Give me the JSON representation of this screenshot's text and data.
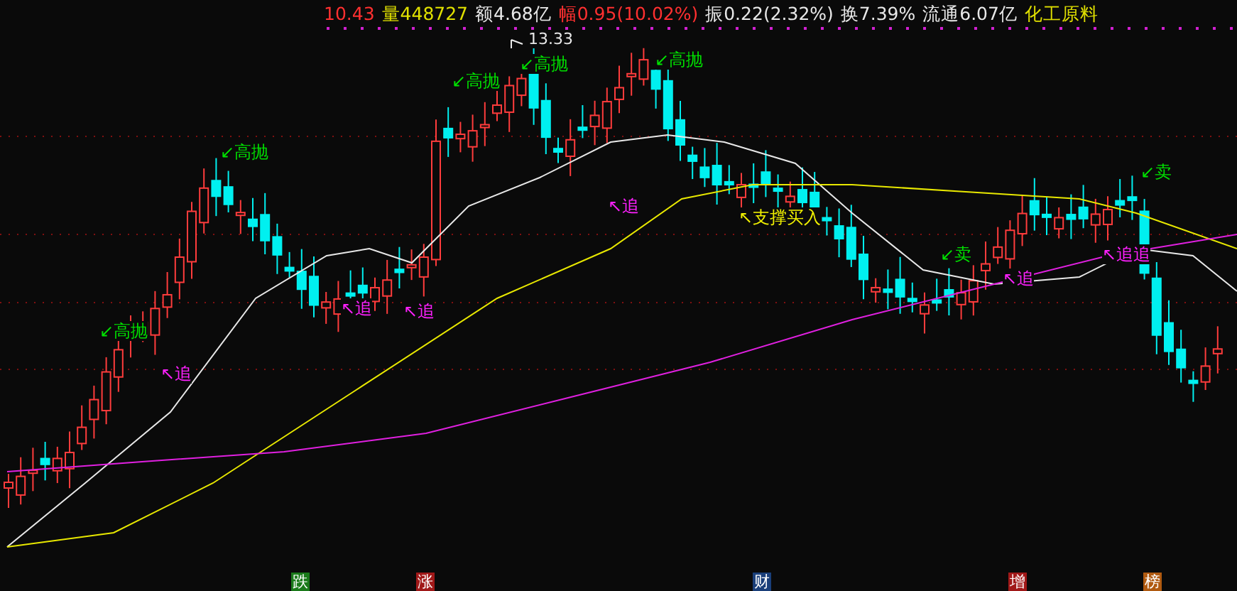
{
  "quote_bar": [
    {
      "text": "10.43",
      "color": "#ff3030"
    },
    {
      "text": "量448727",
      "color": "#e0e000"
    },
    {
      "text": "额4.68亿",
      "color": "#e8e8e8"
    },
    {
      "text": "幅0.95(10.02%)",
      "color": "#ff3030"
    },
    {
      "text": "振0.22(2.32%)",
      "color": "#e8e8e8"
    },
    {
      "text": "换7.39%",
      "color": "#e8e8e8"
    },
    {
      "text": "流通6.07亿",
      "color": "#e8e8e8"
    },
    {
      "text": "化工原料",
      "color": "#e0e000"
    }
  ],
  "chart": {
    "high_label": "13.33",
    "signals": [
      {
        "kind": "sell-high",
        "text": "↙高抛"
      },
      {
        "kind": "chase",
        "text": "↖追"
      },
      {
        "kind": "sell-high",
        "text": "↙高抛"
      },
      {
        "kind": "chase",
        "text": "↖追"
      },
      {
        "kind": "chase",
        "text": "↖追"
      },
      {
        "kind": "sell-high",
        "text": "↙高抛"
      },
      {
        "kind": "sell-high",
        "text": "↙高抛"
      },
      {
        "kind": "chase",
        "text": "↖追"
      },
      {
        "kind": "sell-high",
        "text": "↙高抛"
      },
      {
        "kind": "buy",
        "text": "↖支撑买入"
      },
      {
        "kind": "sell",
        "text": "↙卖"
      },
      {
        "kind": "chase",
        "text": "↖追"
      },
      {
        "kind": "chase",
        "text": "↖追追"
      },
      {
        "kind": "sell",
        "text": "↙卖"
      }
    ]
  },
  "event_tags": [
    {
      "text": "跌",
      "color": "#1a7a1a"
    },
    {
      "text": "涨",
      "color": "#a01818"
    },
    {
      "text": "财",
      "color": "#1a3f7a"
    },
    {
      "text": "增",
      "color": "#a01818"
    },
    {
      "text": "榜",
      "color": "#b05a10"
    }
  ]
}
